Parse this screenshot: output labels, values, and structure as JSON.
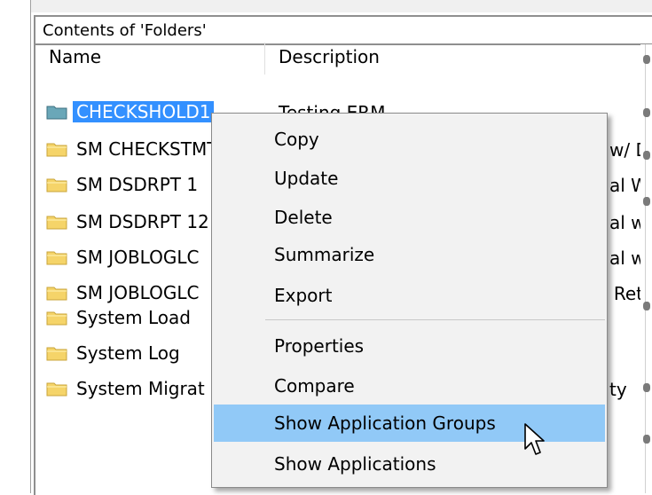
{
  "panel": {
    "title": "Contents of 'Folders'"
  },
  "columns": {
    "name": "Name",
    "description": "Description"
  },
  "rows": [
    {
      "name": "CHECKSHOLD1",
      "description": "Testing ERM",
      "selected": true
    },
    {
      "name": "SM CHECKSTMT",
      "description": "w/ D"
    },
    {
      "name": "SM DSDRPT 1",
      "description": "al Wr"
    },
    {
      "name": "SM DSDRPT 12",
      "description": "al w/"
    },
    {
      "name": "SM JOBLOGLC",
      "description": "al wit"
    },
    {
      "name": "SM JOBLOGLC",
      "description": "' Retr"
    },
    {
      "name": "System Load",
      "description": ""
    },
    {
      "name": "System Log",
      "description": ""
    },
    {
      "name": "System Migrat",
      "description": "ty"
    }
  ],
  "context_menu": {
    "items": [
      {
        "label": "Copy"
      },
      {
        "label": "Update"
      },
      {
        "label": "Delete"
      },
      {
        "label": "Summarize"
      },
      {
        "label": "Export"
      },
      {
        "label": "Properties"
      },
      {
        "label": "Compare"
      },
      {
        "label": "Show Application Groups",
        "highlighted": true
      },
      {
        "label": "Show Applications"
      }
    ]
  },
  "colors": {
    "selection": "#3390ff",
    "menu_highlight": "#91c9f7",
    "menu_background": "#f2f2f2",
    "folder_yellow": "#f5d469",
    "folder_selected": "#6aa7b8"
  },
  "icons": {
    "folder": "folder-icon",
    "cursor": "arrow-cursor-icon"
  }
}
